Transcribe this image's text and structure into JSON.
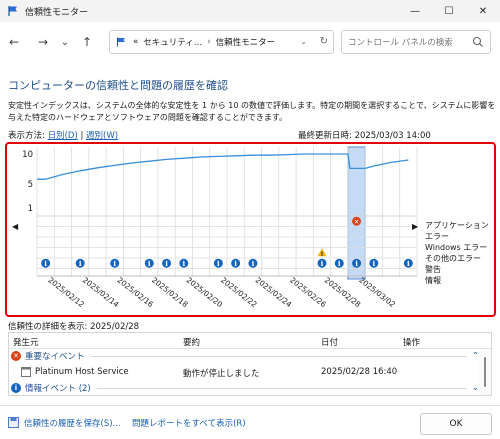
{
  "window": {
    "title": "信頼性モニター",
    "minimize": "—",
    "maximize": "☐",
    "close": "✕"
  },
  "nav": {
    "back": "←",
    "forward": "→",
    "recent": "⌄",
    "up": "↑",
    "breadcrumb_prefix": "«",
    "breadcrumb_1": "セキュリティ…",
    "breadcrumb_2": "信頼性モニター",
    "search_placeholder": "コントロール パネルの検索"
  },
  "page": {
    "heading": "コンピューターの信頼性と問題の履歴を確認",
    "description": "安定性インデックスは、システムの全体的な安定性を 1 から 10 の数値で評価します。特定の期間を選択することで、システムに影響を与えた特定のハードウェアとソフトウェアの問題を確認することができます。",
    "view_by_label": "表示方法:",
    "view_daily": "日別(D)",
    "view_separator": "|",
    "view_weekly": "週別(W)",
    "last_updated_label": "最終更新日時:",
    "last_updated_value": "2025/03/03 14:00"
  },
  "chart_data": {
    "type": "line",
    "y_ticks": [
      "10",
      "5",
      "1"
    ],
    "ylim": [
      1,
      10
    ],
    "x_labels": [
      "2025/02/12",
      "2025/02/14",
      "2025/02/16",
      "2025/02/18",
      "2025/02/20",
      "2025/02/22",
      "2025/02/24",
      "2025/02/26",
      "2025/02/28",
      "2025/03/02"
    ],
    "stability_index": [
      5.8,
      6.6,
      7.2,
      7.7,
      8.1,
      8.5,
      8.8,
      9.1,
      9.3,
      9.5,
      9.6,
      9.7,
      9.8,
      9.8,
      9.9,
      10.0,
      10.0,
      10.0,
      7.6,
      8.0,
      8.6,
      9.0
    ],
    "selected_column": 18,
    "legend": [
      "アプリケーション エラー",
      "Windows エラー",
      "その他のエラー",
      "警告",
      "情報"
    ],
    "app_error_columns": [
      18
    ],
    "warning_columns": [
      16
    ],
    "info_columns": [
      0,
      2,
      4,
      6,
      7,
      8,
      10,
      11,
      12,
      16,
      17,
      18,
      19,
      21
    ]
  },
  "details": {
    "label_prefix": "信頼性の詳細を表示:",
    "label_date": "2025/02/28",
    "columns": [
      "発生元",
      "要約",
      "日付",
      "操作"
    ],
    "critical_group": "重要なイベント",
    "rows": [
      {
        "source": "Platinum Host Service",
        "summary": "動作が停止しました",
        "date": "2025/02/28 16:40",
        "action": ""
      }
    ],
    "info_group": "情報イベント (2)"
  },
  "footer": {
    "save_history": "信頼性の履歴を保存(S)...",
    "view_all_reports": "問題レポートをすべて表示(R)",
    "ok": "OK"
  },
  "colors": {
    "line": "#3a8fd9",
    "selected": "#c4daf5",
    "selected_border": "#5a8fd0",
    "error": "#d84315",
    "info": "#1565c0",
    "warning": "#f0b400",
    "highlight_border": "#e00000"
  }
}
